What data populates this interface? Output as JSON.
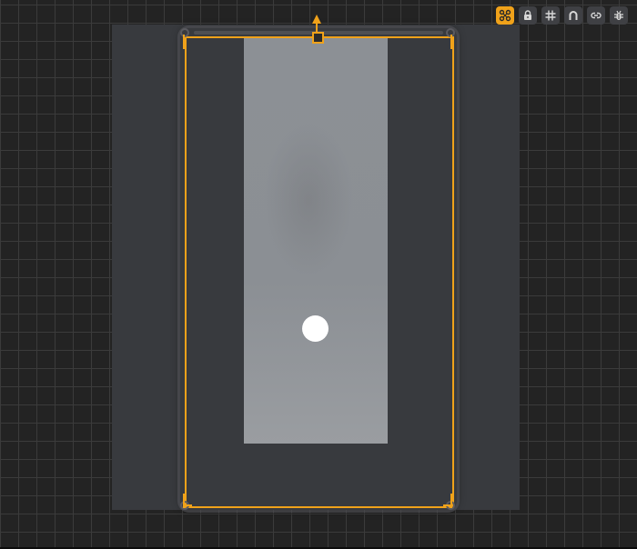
{
  "toolbar": {
    "buttons": [
      {
        "name": "transform-toggle-button",
        "icon": "transform-handles-icon",
        "active": true
      },
      {
        "name": "lock-button",
        "icon": "lock-icon",
        "active": false
      },
      {
        "name": "grid-button",
        "icon": "grid-icon",
        "active": false
      },
      {
        "name": "snap-magnet-button",
        "icon": "magnet-icon",
        "active": false
      },
      {
        "name": "link-button",
        "icon": "link-icon",
        "active": false
      },
      {
        "name": "debug-button",
        "icon": "bug-icon",
        "active": false
      }
    ]
  },
  "colors": {
    "accent": "#f0a21a",
    "workspace_background": "#232323",
    "grid_lines": "#3b3b3b",
    "canvas": "#383a3e",
    "image_layer": "#8c9095",
    "anchor": "#ffffff",
    "toolbar_button": "#3f4044"
  }
}
